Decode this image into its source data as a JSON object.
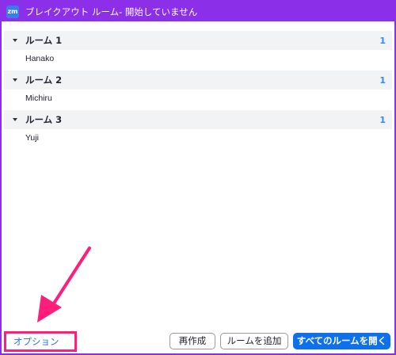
{
  "window": {
    "title": "ブレイクアウト ルーム- 開始していません",
    "app_icon_text": "zm"
  },
  "rooms": [
    {
      "name": "ルーム 1",
      "count": "1",
      "members": [
        "Hanako"
      ]
    },
    {
      "name": "ルーム 2",
      "count": "1",
      "members": [
        "Michiru"
      ]
    },
    {
      "name": "ルーム 3",
      "count": "1",
      "members": [
        "Yuji"
      ]
    }
  ],
  "footer": {
    "options_label": "オプション",
    "recreate_label": "再作成",
    "add_room_label": "ルームを追加",
    "open_all_label": "すべてのルームを開く"
  },
  "colors": {
    "titlebar": "#8c2fe8",
    "accent_blue": "#0e71eb",
    "highlight_pink": "#ff1e7a"
  }
}
